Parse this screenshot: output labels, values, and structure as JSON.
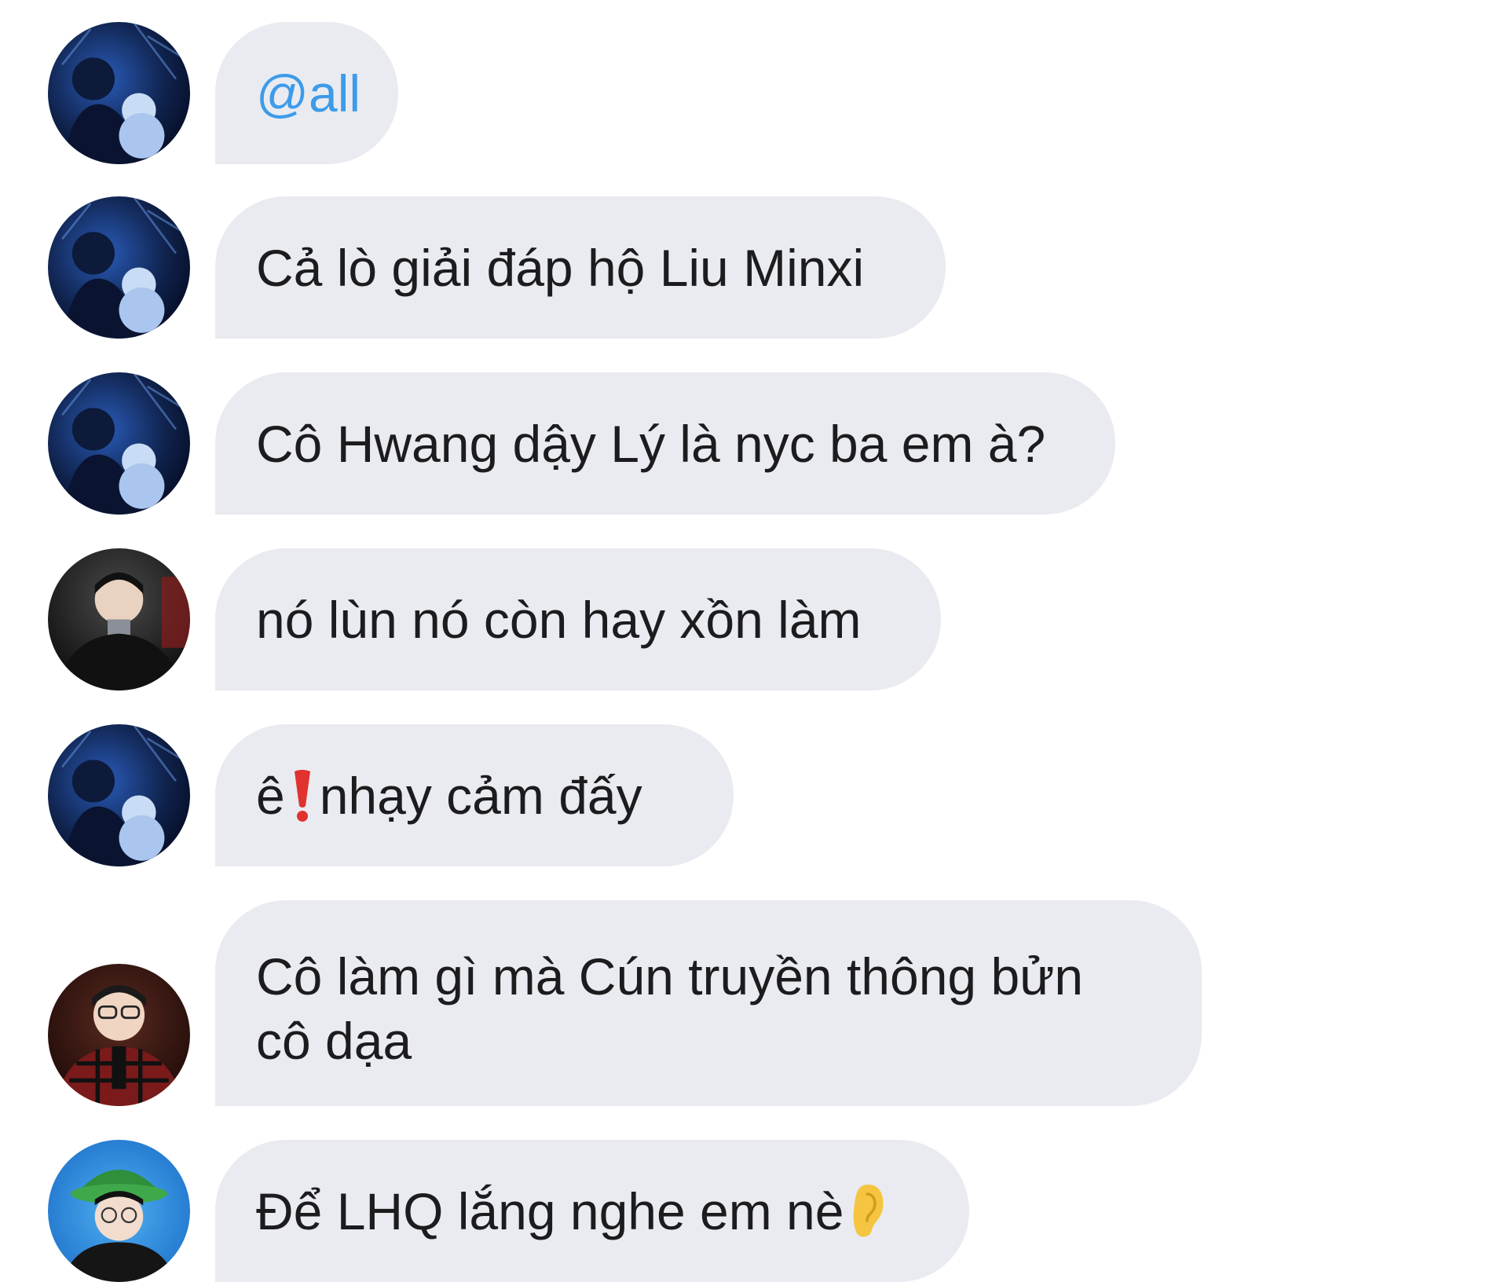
{
  "messages": [
    {
      "id": "m1",
      "avatar": "blue-night-avatar",
      "text": "@all",
      "is_mention": true
    },
    {
      "id": "m2",
      "avatar": "blue-night-avatar",
      "text": "Cả lò giải đáp hộ Liu Minxi"
    },
    {
      "id": "m3",
      "avatar": "blue-night-avatar",
      "text": "Cô Hwang dậy Lý là nyc ba em à?"
    },
    {
      "id": "m4",
      "avatar": "dark-coat-avatar",
      "text": "nó lùn nó còn hay xồn làm"
    },
    {
      "id": "m5",
      "avatar": "blue-night-avatar",
      "text_before": "ê",
      "emoji": "red-exclamation-icon",
      "text_after": "nhạy cảm đấy"
    },
    {
      "id": "m6",
      "avatar": "red-plaid-avatar",
      "line1": "Cô làm gì mà Cún truyền thông bửn",
      "line2": "cô dạa"
    },
    {
      "id": "m7",
      "avatar": "green-hat-avatar",
      "text": "Để LHQ lắng nghe em nè",
      "emoji": "ear-icon"
    }
  ],
  "colors": {
    "bubble_bg": "#e9ebf0",
    "text": "#1c1c1e",
    "mention": "#3d9be9",
    "page_bg": "#ffffff"
  }
}
